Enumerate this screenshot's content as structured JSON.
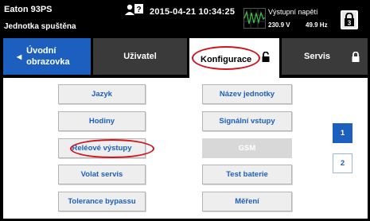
{
  "header": {
    "device_name": "Eaton 93PS",
    "unit_status": "Jednotka spuštěna",
    "datetime": "2015-04-21 10:34:25",
    "meter_title": "Výstupní napětí",
    "voltage": "230.9 V",
    "frequency": "49.9 Hz",
    "lock_level": "3"
  },
  "tabs": {
    "home": "Úvodní obrazovka",
    "user": "Uživatel",
    "config": "Konfigurace",
    "service": "Servis"
  },
  "buttons": {
    "left": [
      "Jazyk",
      "Hodiny",
      "Reléové výstupy",
      "Volat servis",
      "Tolerance bypassu"
    ],
    "right": [
      "Název jednotky",
      "Signální vstupy",
      "GSM",
      "Test baterie",
      "Měření"
    ]
  },
  "pages": [
    "1",
    "2"
  ],
  "colors": {
    "accent": "#1c5fbe",
    "tab_inactive": "#3a3a3a",
    "highlight_ring": "#d0141c"
  }
}
